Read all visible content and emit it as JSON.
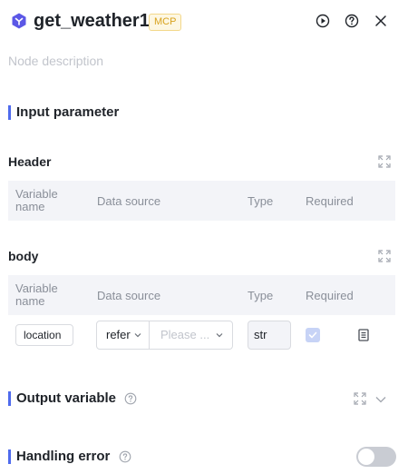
{
  "header": {
    "title": "get_weather1",
    "badge": "MCP",
    "icons": [
      "run-icon",
      "help-icon",
      "close-icon"
    ]
  },
  "description_placeholder": "Node description",
  "input_parameter": {
    "title": "Input parameter",
    "header_section": {
      "label": "Header",
      "columns": [
        "Variable\nname",
        "Data source",
        "Type",
        "Required"
      ]
    },
    "body_section": {
      "label": "body",
      "columns": [
        "Variable\nname",
        "Data source",
        "Type",
        "Required"
      ],
      "rows": [
        {
          "variable_name": "location",
          "source_mode": "refer",
          "source_placeholder": "Please ...",
          "type": "str",
          "required": true
        }
      ]
    }
  },
  "output_variable": {
    "title": "Output variable"
  },
  "handling_error": {
    "title": "Handling error",
    "enabled": false
  },
  "colors": {
    "accent": "#4f6bed",
    "badge_text": "#d8a21e",
    "icon_purple": "#5b57e6"
  }
}
